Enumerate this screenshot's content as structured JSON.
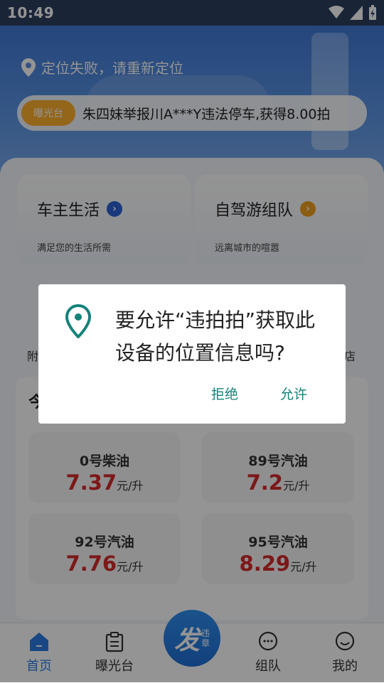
{
  "status_bar": {
    "time": "10:49"
  },
  "header": {
    "location_text": "定位失败，请重新定位",
    "ticker_badge": "曝光台",
    "ticker_text": "朱四妹举报川A***Y违法停车,获得8.00拍"
  },
  "cards": [
    {
      "title": "车主生活",
      "subtitle": "满足您的生活所需",
      "arrow_color": "#2b62d6"
    },
    {
      "title": "自驾游组队",
      "subtitle": "远离城市的喧嚣",
      "arrow_color": "#f0a020"
    }
  ],
  "partial_labels": {
    "left": "附",
    "right": "店",
    "panel_title": "今"
  },
  "fuel_prices": [
    {
      "name": "0号柴油",
      "price": "7.37",
      "unit": "元/升"
    },
    {
      "name": "89号汽油",
      "price": "7.2",
      "unit": "元/升"
    },
    {
      "name": "92号汽油",
      "price": "7.76",
      "unit": "元/升"
    },
    {
      "name": "95号汽油",
      "price": "8.29",
      "unit": "元/升"
    }
  ],
  "tabs": [
    {
      "label": "首页",
      "icon": "home-icon",
      "active": true
    },
    {
      "label": "曝光台",
      "icon": "clipboard-icon"
    },
    {
      "label": "组队",
      "icon": "chat-icon"
    },
    {
      "label": "我的",
      "icon": "smiley-icon"
    }
  ],
  "fab": {
    "main": "发",
    "sub1": "违",
    "sub2": "章"
  },
  "dialog": {
    "message": "要允许“违拍拍”获取此设备的位置信息吗?",
    "deny": "拒绝",
    "allow": "允许",
    "accent": "#14827a"
  },
  "colors": {
    "tab_active": "#2b7be4",
    "price_red": "#d62a2a"
  }
}
